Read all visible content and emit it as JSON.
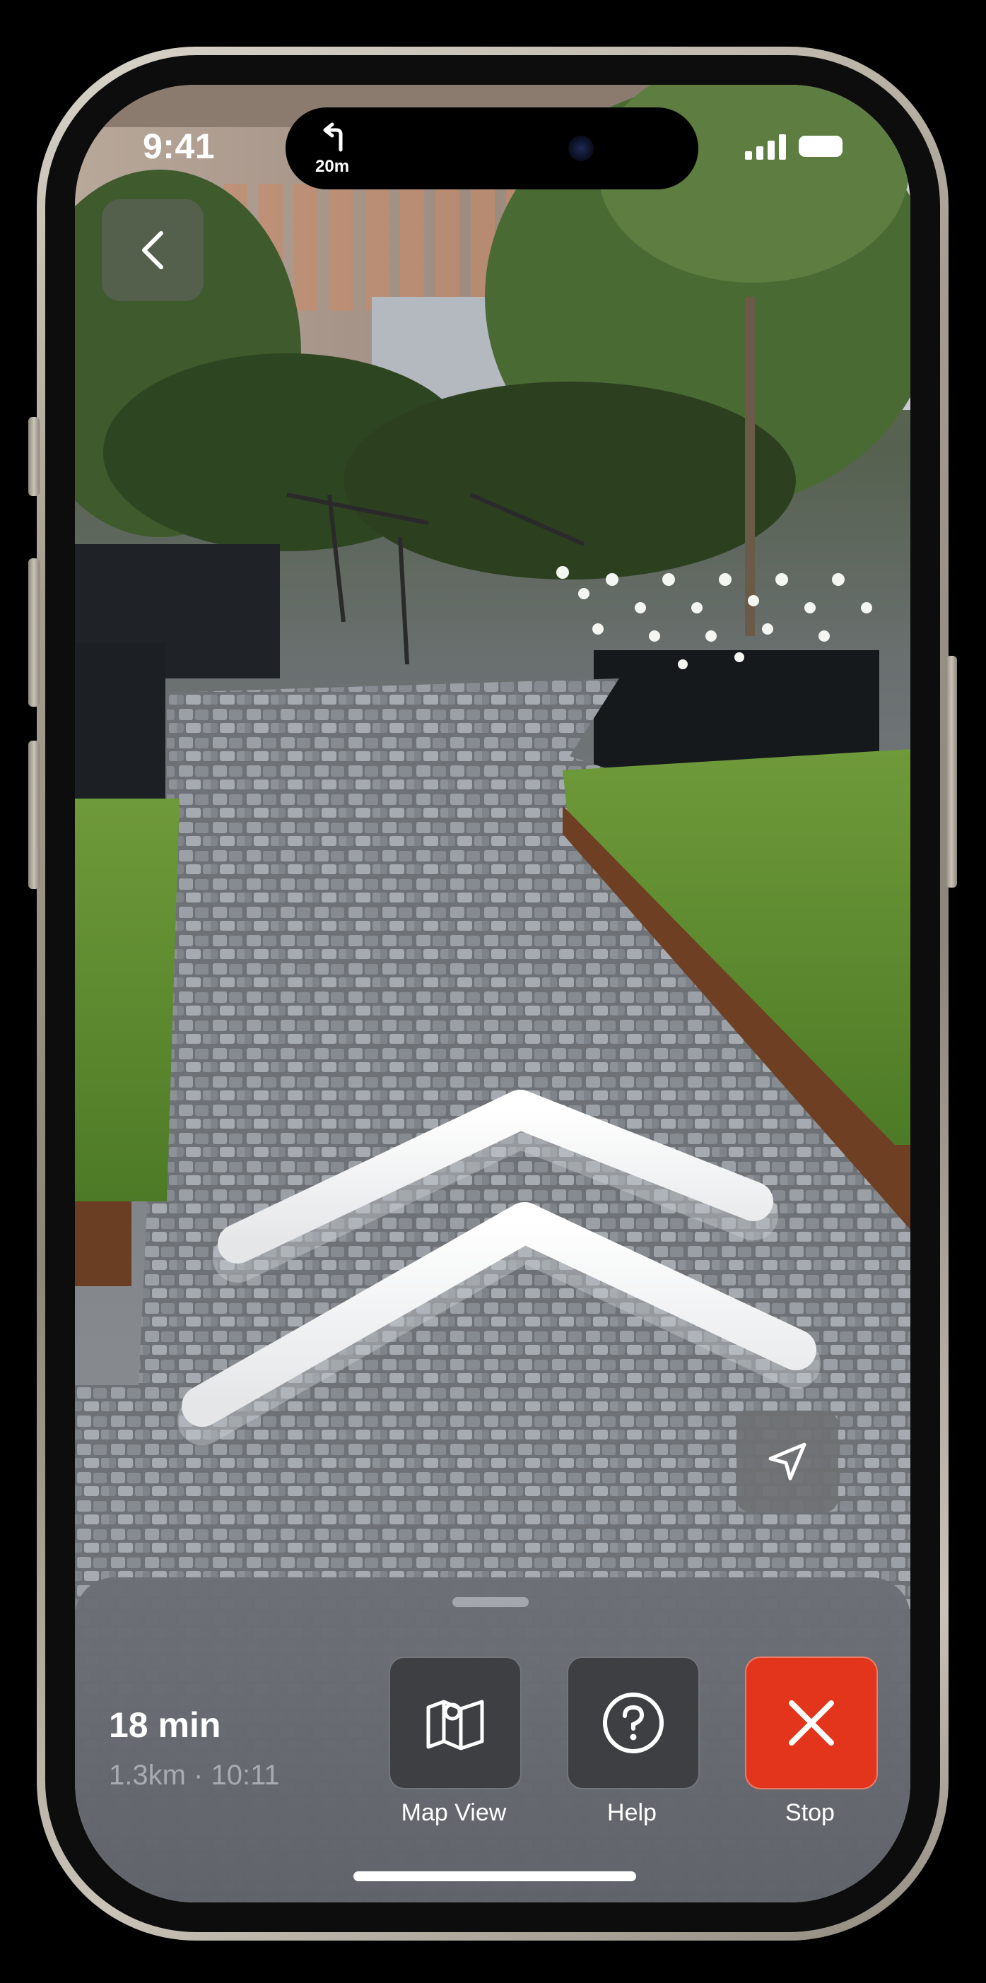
{
  "status_bar": {
    "time": "9:41",
    "next_turn": {
      "icon": "turn-left-icon",
      "distance": "20m"
    },
    "signal_icon": "cellular-signal-icon",
    "battery_icon": "battery-icon"
  },
  "navigation": {
    "back_icon": "chevron-left-icon",
    "recenter_icon": "location-arrow-icon",
    "guide_arrow_icon": "ar-chevron-up-icon"
  },
  "trip": {
    "eta": "18 min",
    "distance_and_arrival": "1.3km · 10:11"
  },
  "actions": [
    {
      "label": "Map View",
      "icon": "map-icon"
    },
    {
      "label": "Help",
      "icon": "question-icon"
    },
    {
      "label": "Stop",
      "icon": "close-icon"
    }
  ],
  "colors": {
    "stop": "#e2351b",
    "action_bg": "#3d3f42",
    "sheet_bg": "#666a70"
  }
}
